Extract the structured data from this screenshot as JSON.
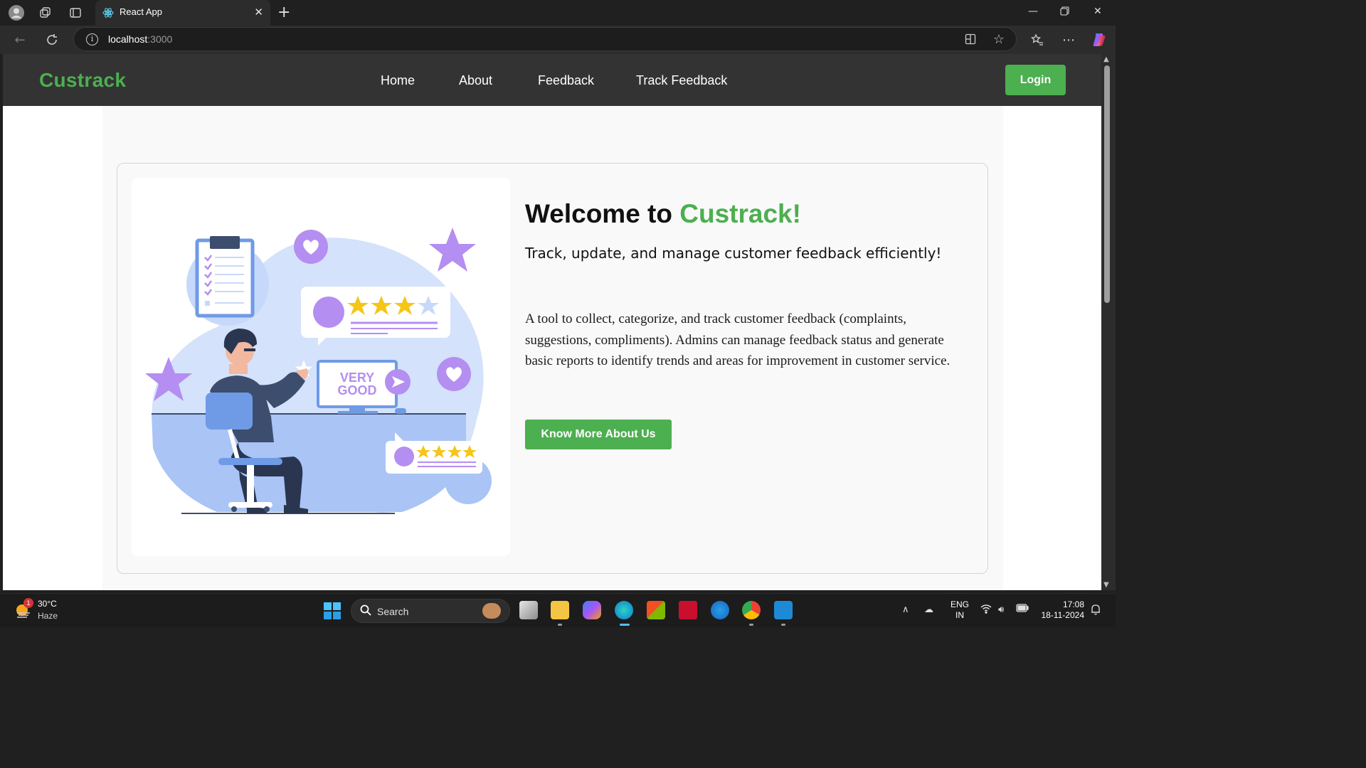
{
  "browser": {
    "tab_title": "React App",
    "url_host": "localhost",
    "url_port": ":3000"
  },
  "navbar": {
    "brand": "Custrack",
    "links": [
      "Home",
      "About",
      "Feedback",
      "Track Feedback"
    ],
    "login_label": "Login"
  },
  "hero": {
    "heading_prefix": "Welcome to ",
    "heading_accent": "Custrack!",
    "subheading": "Track, update, and manage customer feedback efficiently!",
    "description": "A tool to collect, categorize, and track customer feedback (complaints, suggestions, compliments). Admins can manage feedback status and generate basic reports to identify trends and areas for improvement in customer service.",
    "cta_label": "Know More About Us",
    "illustration_text_1": "VERY",
    "illustration_text_2": "GOOD"
  },
  "colors": {
    "accent": "#4caf50",
    "navbar_bg": "#333333",
    "card_bg": "#f9f9f9",
    "illustration_purple": "#b48ef0",
    "illustration_blue": "#a9c4f5"
  },
  "taskbar": {
    "weather_badge": "1",
    "weather_temp": "30°C",
    "weather_cond": "Haze",
    "search_label": "Search",
    "lang_1": "ENG",
    "lang_2": "IN",
    "time": "17:08",
    "date": "18-11-2024"
  },
  "icons": [
    "profile-icon",
    "workspaces-icon",
    "tab-actions-icon",
    "react-favicon-icon",
    "close-icon",
    "new-tab-icon",
    "minimize-icon",
    "restore-icon",
    "window-close-icon",
    "back-icon",
    "refresh-icon",
    "info-icon",
    "split-screen-icon",
    "favorite-star-icon",
    "favorites-icon",
    "more-icon",
    "copilot-icon",
    "windows-start-icon",
    "search-icon"
  ]
}
